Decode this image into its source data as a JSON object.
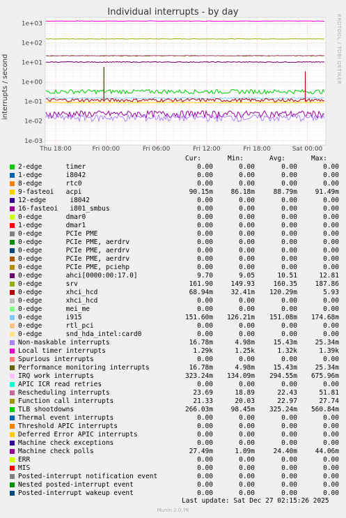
{
  "chart_data": {
    "type": "line",
    "title": "Individual interrupts - by day",
    "ylabel": "interrupts / second",
    "yscale": "log",
    "ylim": [
      0.0006,
      2000
    ],
    "yticks": [
      "1e-03",
      "1e-02",
      "1e-01",
      "1e+00",
      "1e+01",
      "1e+02",
      "1e+03"
    ],
    "xticks": [
      "Thu 18:00",
      "Fri 00:00",
      "Fri 06:00",
      "Fri 12:00",
      "Fri 18:00",
      "Sat 00:00"
    ],
    "grid": true,
    "side_text": "RRDTOOL / TOBI OETIKER",
    "columns": [
      "Cur:",
      "Min:",
      "Avg:",
      "Max:"
    ],
    "series": [
      {
        "name": "2-edge      timer",
        "color": "#00cc00",
        "cur": "0.00",
        "min": "0.00",
        "avg": "0.00",
        "max": "0.00"
      },
      {
        "name": "1-edge      i8042",
        "color": "#0066b3",
        "cur": "0.00",
        "min": "0.00",
        "avg": "0.00",
        "max": "0.00"
      },
      {
        "name": "8-edge      rtc0",
        "color": "#ff8000",
        "cur": "0.00",
        "min": "0.00",
        "avg": "0.00",
        "max": "0.00"
      },
      {
        "name": "9-fasteoi   acpi",
        "color": "#ffcc00",
        "cur": "90.15m",
        "min": "86.18m",
        "avg": "88.79m",
        "max": "91.49m"
      },
      {
        "name": "12-edge      i8042",
        "color": "#330099",
        "cur": "0.00",
        "min": "0.00",
        "avg": "0.00",
        "max": "0.00"
      },
      {
        "name": "16-fasteoi   i801_smbus",
        "color": "#990099",
        "cur": "0.00",
        "min": "0.00",
        "avg": "0.00",
        "max": "0.00"
      },
      {
        "name": "0-edge      dmar0",
        "color": "#ccff00",
        "cur": "0.00",
        "min": "0.00",
        "avg": "0.00",
        "max": "0.00"
      },
      {
        "name": "1-edge      dmar1",
        "color": "#ff0000",
        "cur": "0.00",
        "min": "0.00",
        "avg": "0.00",
        "max": "0.00"
      },
      {
        "name": "0-edge      PCIe PME",
        "color": "#808080",
        "cur": "0.00",
        "min": "0.00",
        "avg": "0.00",
        "max": "0.00"
      },
      {
        "name": "0-edge      PCIe PME, aerdrv",
        "color": "#008f00",
        "cur": "0.00",
        "min": "0.00",
        "avg": "0.00",
        "max": "0.00"
      },
      {
        "name": "0-edge      PCIe PME, aerdrv",
        "color": "#00487d",
        "cur": "0.00",
        "min": "0.00",
        "avg": "0.00",
        "max": "0.00"
      },
      {
        "name": "0-edge      PCIe PME, aerdrv",
        "color": "#b35a00",
        "cur": "0.00",
        "min": "0.00",
        "avg": "0.00",
        "max": "0.00"
      },
      {
        "name": "0-edge      PCIe PME, pciehp",
        "color": "#b38f00",
        "cur": "0.00",
        "min": "0.00",
        "avg": "0.00",
        "max": "0.00"
      },
      {
        "name": "0-edge      ahci[0000:00:17.0]",
        "color": "#6b006b",
        "cur": "9.70",
        "min": "9.05",
        "avg": "10.51",
        "max": "12.81"
      },
      {
        "name": "0-edge      srv",
        "color": "#8fb300",
        "cur": "161.90",
        "min": "149.93",
        "avg": "160.35",
        "max": "187.86"
      },
      {
        "name": "0-edge      xhci_hcd",
        "color": "#b30000",
        "cur": "68.94m",
        "min": "32.41m",
        "avg": "120.29m",
        "max": "5.93"
      },
      {
        "name": "0-edge      xhci_hcd",
        "color": "#bebebe",
        "cur": "0.00",
        "min": "0.00",
        "avg": "0.00",
        "max": "0.00"
      },
      {
        "name": "0-edge      mei_me",
        "color": "#80ff80",
        "cur": "0.00",
        "min": "0.00",
        "avg": "0.00",
        "max": "0.00"
      },
      {
        "name": "0-edge      i915",
        "color": "#80c9ff",
        "cur": "151.60m",
        "min": "126.21m",
        "avg": "151.08m",
        "max": "174.68m"
      },
      {
        "name": "0-edge      rtl_pci",
        "color": "#ffc080",
        "cur": "0.00",
        "min": "0.00",
        "avg": "0.00",
        "max": "0.00"
      },
      {
        "name": "0-edge      snd_hda_intel:card0",
        "color": "#ffe680",
        "cur": "0.00",
        "min": "0.00",
        "avg": "0.00",
        "max": "0.00"
      },
      {
        "name": "Non-maskable interrupts",
        "color": "#aa80ff",
        "cur": "16.78m",
        "min": "4.98m",
        "avg": "15.43m",
        "max": "25.34m"
      },
      {
        "name": "Local timer interrupts",
        "color": "#ee00cc",
        "cur": "1.29k",
        "min": "1.25k",
        "avg": "1.32k",
        "max": "1.39k"
      },
      {
        "name": "Spurious interrupts",
        "color": "#ff8080",
        "cur": "0.00",
        "min": "0.00",
        "avg": "0.00",
        "max": "0.00"
      },
      {
        "name": "Performance monitoring interrupts",
        "color": "#666600",
        "cur": "16.78m",
        "min": "4.98m",
        "avg": "15.43m",
        "max": "25.34m"
      },
      {
        "name": "IRQ work interrupts",
        "color": "#ffbfff",
        "cur": "323.24m",
        "min": "134.09m",
        "avg": "294.55m",
        "max": "675.96m"
      },
      {
        "name": "APIC ICR read retries",
        "color": "#00ffcc",
        "cur": "0.00",
        "min": "0.00",
        "avg": "0.00",
        "max": "0.00"
      },
      {
        "name": "Rescheduling interrupts",
        "color": "#cc6699",
        "cur": "23.69",
        "min": "18.89",
        "avg": "22.43",
        "max": "51.81"
      },
      {
        "name": "Function call interrupts",
        "color": "#999900",
        "cur": "21.33",
        "min": "20.03",
        "avg": "22.97",
        "max": "27.74"
      },
      {
        "name": "TLB shootdowns",
        "color": "#00cc00",
        "cur": "266.03m",
        "min": "98.45m",
        "avg": "325.24m",
        "max": "560.84m"
      },
      {
        "name": "Thermal event interrupts",
        "color": "#0066b3",
        "cur": "0.00",
        "min": "0.00",
        "avg": "0.00",
        "max": "0.00"
      },
      {
        "name": "Threshold APIC interrupts",
        "color": "#ff8000",
        "cur": "0.00",
        "min": "0.00",
        "avg": "0.00",
        "max": "0.00"
      },
      {
        "name": "Deferred Error APIC interrupts",
        "color": "#ffcc00",
        "cur": "0.00",
        "min": "0.00",
        "avg": "0.00",
        "max": "0.00"
      },
      {
        "name": "Machine check exceptions",
        "color": "#330099",
        "cur": "0.00",
        "min": "0.00",
        "avg": "0.00",
        "max": "0.00"
      },
      {
        "name": "Machine check polls",
        "color": "#990099",
        "cur": "27.49m",
        "min": "1.09m",
        "avg": "24.40m",
        "max": "44.06m"
      },
      {
        "name": "ERR",
        "color": "#ccff00",
        "cur": "0.00",
        "min": "0.00",
        "avg": "0.00",
        "max": "0.00"
      },
      {
        "name": "MIS",
        "color": "#ff0000",
        "cur": "0.00",
        "min": "0.00",
        "avg": "0.00",
        "max": "0.00"
      },
      {
        "name": "Posted-interrupt notification event",
        "color": "#808080",
        "cur": "0.00",
        "min": "0.00",
        "avg": "0.00",
        "max": "0.00"
      },
      {
        "name": "Nested posted-interrupt event",
        "color": "#008f00",
        "cur": "0.00",
        "min": "0.00",
        "avg": "0.00",
        "max": "0.00"
      },
      {
        "name": "Posted-interrupt wakeup event",
        "color": "#00487d",
        "cur": "0.00",
        "min": "0.00",
        "avg": "0.00",
        "max": "0.00"
      }
    ],
    "plotted_lines": [
      {
        "color": "#ee00cc",
        "value": 1300,
        "noise": 0.03
      },
      {
        "color": "#8fb300",
        "value": 160,
        "noise": 0.03
      },
      {
        "color": "#666600",
        "value": 22,
        "noise": 0.04
      },
      {
        "color": "#cc6699",
        "value": 22.4,
        "noise": 0.05
      },
      {
        "color": "#6b006b",
        "value": 10.5,
        "noise": 0.05
      },
      {
        "color": "#00cc00",
        "value": 0.33,
        "noise": 0.25
      },
      {
        "color": "#80c9ff",
        "value": 0.15,
        "noise": 0.1
      },
      {
        "color": "#b30000",
        "value": 0.12,
        "noise": 0.2
      },
      {
        "color": "#ffcc00",
        "value": 0.089,
        "noise": 0.03
      },
      {
        "color": "#990099",
        "value": 0.024,
        "noise": 0.4
      },
      {
        "color": "#aa80ff",
        "value": 0.0154,
        "noise": 0.4
      }
    ],
    "peaks": [
      {
        "x": "Fri 00:00",
        "color": "#b30000",
        "value": 5.93
      },
      {
        "x": "Sat 00:00",
        "color": "#b30000",
        "value": 3.5
      }
    ],
    "last_update": "Last update: Sat Dec 27 02:15:26 2025",
    "footer": "Munin 2.0.76"
  }
}
